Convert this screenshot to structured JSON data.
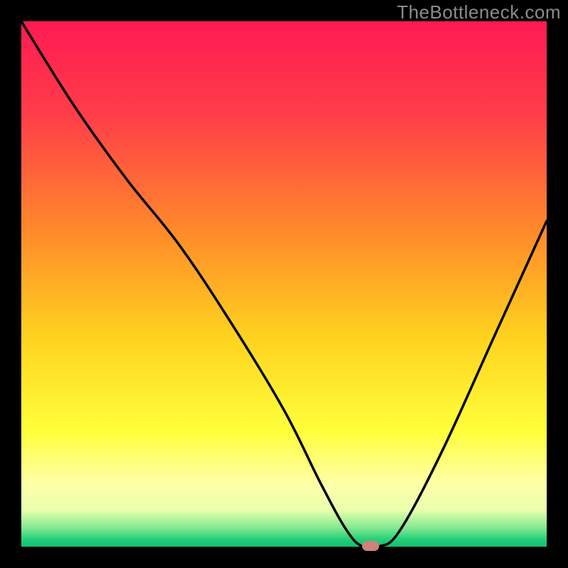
{
  "watermark": "TheBottleneck.com",
  "chart_data": {
    "type": "line",
    "title": "",
    "xlabel": "",
    "ylabel": "",
    "xlim": [
      0,
      100
    ],
    "ylim": [
      0,
      100
    ],
    "x": [
      0,
      10,
      20,
      30,
      40,
      50,
      57,
      62,
      65,
      68,
      72,
      80,
      90,
      100
    ],
    "values": [
      100,
      84,
      70,
      57.5,
      42.5,
      26,
      12,
      3,
      0,
      0,
      3,
      18,
      40,
      62
    ],
    "marker": {
      "x": 66.5,
      "y": 0
    },
    "gradient_stops": [
      {
        "offset": 0.0,
        "color": "#ff1a52"
      },
      {
        "offset": 0.18,
        "color": "#ff3e49"
      },
      {
        "offset": 0.4,
        "color": "#ff8a2a"
      },
      {
        "offset": 0.6,
        "color": "#ffd21f"
      },
      {
        "offset": 0.78,
        "color": "#ffff3a"
      },
      {
        "offset": 0.88,
        "color": "#ffffa8"
      },
      {
        "offset": 0.93,
        "color": "#eaffac"
      },
      {
        "offset": 0.965,
        "color": "#7fe88f"
      },
      {
        "offset": 0.985,
        "color": "#29d07a"
      },
      {
        "offset": 1.0,
        "color": "#0fbf6e"
      }
    ]
  }
}
